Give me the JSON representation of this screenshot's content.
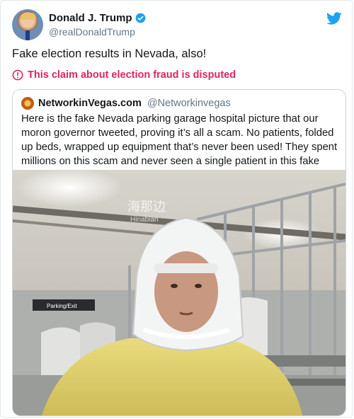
{
  "tweet": {
    "author_name": "Donald J. Trump",
    "author_handle": "@realDonaldTrump",
    "text": "Fake election results in Nevada, also!",
    "disputed_label": "This claim about election fraud is disputed"
  },
  "quoted": {
    "author_name": "NetworkinVegas.com",
    "author_handle": "@Networkinvegas",
    "text": "Here is the fake Nevada parking garage hospital picture that our moron governor tweeted, proving it’s all a scam. No patients, folded up beds, wrapped up equipment that’s never been used! They spent millions on this scam and never seen a single patient in this fake hospital!",
    "photo": {
      "watermark_cn": "海那边",
      "watermark_en": "Hinabian",
      "sign_text": "Parking/Exit"
    }
  },
  "colors": {
    "twitter_blue": "#1da1f2",
    "disputed_red": "#e0245e"
  },
  "icons": [
    "verified-icon",
    "twitter-bird-icon",
    "warning-icon"
  ]
}
